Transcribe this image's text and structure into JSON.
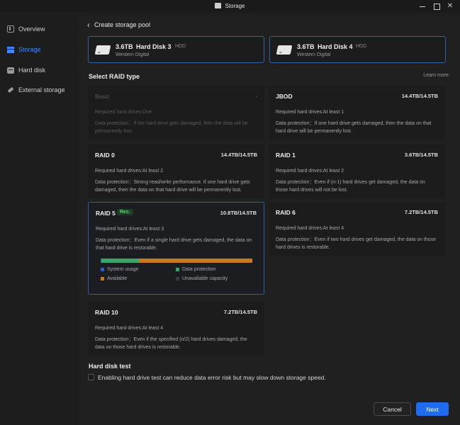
{
  "window": {
    "title": "Storage"
  },
  "sidebar": {
    "items": [
      {
        "label": "Overview",
        "icon": "overview-icon",
        "active": false
      },
      {
        "label": "Storage",
        "icon": "storage-icon",
        "active": true
      },
      {
        "label": "Hard disk",
        "icon": "hard-disk-icon",
        "active": false
      },
      {
        "label": "External storage",
        "icon": "external-storage-icon",
        "active": false
      }
    ]
  },
  "header": {
    "title": "Create storage pool"
  },
  "disks": [
    {
      "capacity": "3.6TB",
      "name": "Hard Disk 3",
      "type": "HDD",
      "maker": "Western Digital"
    },
    {
      "capacity": "3.6TB",
      "name": "Hard Disk 4",
      "type": "HDD",
      "maker": "Western Digital"
    }
  ],
  "raid_section": {
    "title": "Select RAID type",
    "learn_more": "Learn more"
  },
  "raid_types": [
    {
      "name": "Basic",
      "capacity": "-",
      "required": "Required hard drives:One",
      "protection": "Data protection：If the hard drive gets damaged, then the data will be permanently lost."
    },
    {
      "name": "JBOD",
      "capacity": "14.4TB/14.5TB",
      "required": "Required hard drives:At least 1",
      "protection": "Data protection：If one hard drive gets damaged, then the data on that hard drive will be permanently lost."
    },
    {
      "name": "RAID 0",
      "capacity": "14.4TB/14.5TB",
      "required": "Required hard drives:At least 2",
      "protection": "Data protection：Strong read/write performance. If one hard drive gets damaged, then the data on that hard drive will be permanently lost."
    },
    {
      "name": "RAID 1",
      "capacity": "3.6TB/14.5TB",
      "required": "Required hard drives:At least 2",
      "protection": "Data protection：Even if (n-1) hard drives get damaged, the data on those hard drives will not be lost."
    },
    {
      "name": "RAID 5",
      "badge": "Rec.",
      "capacity": "10.8TB/14.5TB",
      "required": "Required hard drives:At least 3",
      "protection": "Data protection：Even if a single hard drive gets damaged, the data on that hard drive is restorable."
    },
    {
      "name": "RAID 6",
      "capacity": "7.2TB/14.5TB",
      "required": "Required hard drives:At least 4",
      "protection": "Data protection：Even if two hard drives get damaged, the data on those hard drives is restorable."
    },
    {
      "name": "RAID 10",
      "capacity": "7.2TB/14.5TB",
      "required": "Required hard drives:At least 4",
      "protection": "Data protection：Even if the specified (n/2) hard drives damaged, the data on those hard drives is restorable."
    }
  ],
  "capacity_legend": {
    "system": "System usage",
    "protection": "Data protection",
    "available": "Available",
    "unavailable": "Unavailable capacity",
    "colors": {
      "system": "#2a62c9",
      "protection": "#3aa56a",
      "available": "#c77a1e",
      "unavailable": "#3a3a3a"
    }
  },
  "hard_disk_test": {
    "title": "Hard disk test",
    "label": "Enabling hard drive test can reduce data error risk but may slow down storage speed.",
    "checked": false
  },
  "footer": {
    "cancel": "Cancel",
    "next": "Next"
  },
  "colors": {
    "accent": "#1f6cf0",
    "selected_border": "#2f5fa8",
    "rec": "#5fd37e"
  }
}
